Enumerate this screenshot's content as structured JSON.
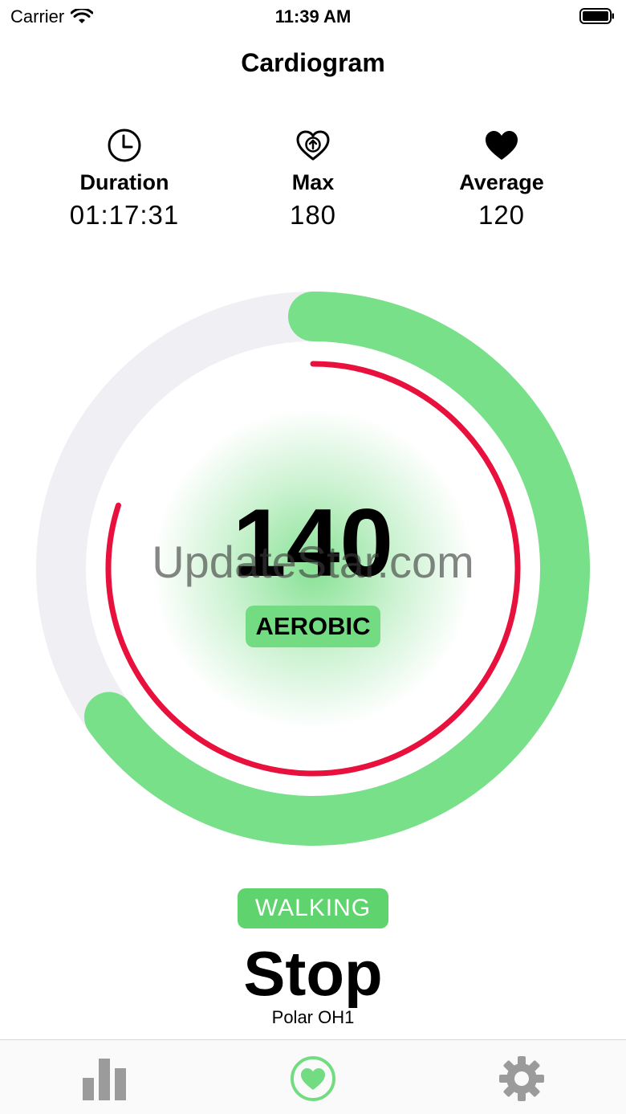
{
  "status_bar": {
    "carrier": "Carrier",
    "time": "11:39 AM"
  },
  "header": {
    "title": "Cardiogram"
  },
  "stats": [
    {
      "icon": "clock-icon",
      "label": "Duration",
      "value": "01:17:31"
    },
    {
      "icon": "heart-arrow-up-icon",
      "label": "Max",
      "value": "180"
    },
    {
      "icon": "heart-filled-icon",
      "label": "Average",
      "value": "120"
    }
  ],
  "gauge": {
    "heart_rate": "140",
    "zone": "AEROBIC",
    "outer_ring_fraction": 0.65,
    "inner_ring_fraction": 0.8,
    "watermark": "UpdateStar.com"
  },
  "activity": {
    "type": "WALKING",
    "action_label": "Stop",
    "device": "Polar OH1"
  },
  "tabs": [
    {
      "icon": "bar-chart-icon",
      "selected": false
    },
    {
      "icon": "heart-icon",
      "selected": true
    },
    {
      "icon": "gear-icon",
      "selected": false
    }
  ],
  "colors": {
    "accent_green": "#73dc82",
    "badge_green": "#5fd36e",
    "track_gray": "#efeff4",
    "ring_red": "#e8103c",
    "icon_gray": "#9b9b9b"
  }
}
